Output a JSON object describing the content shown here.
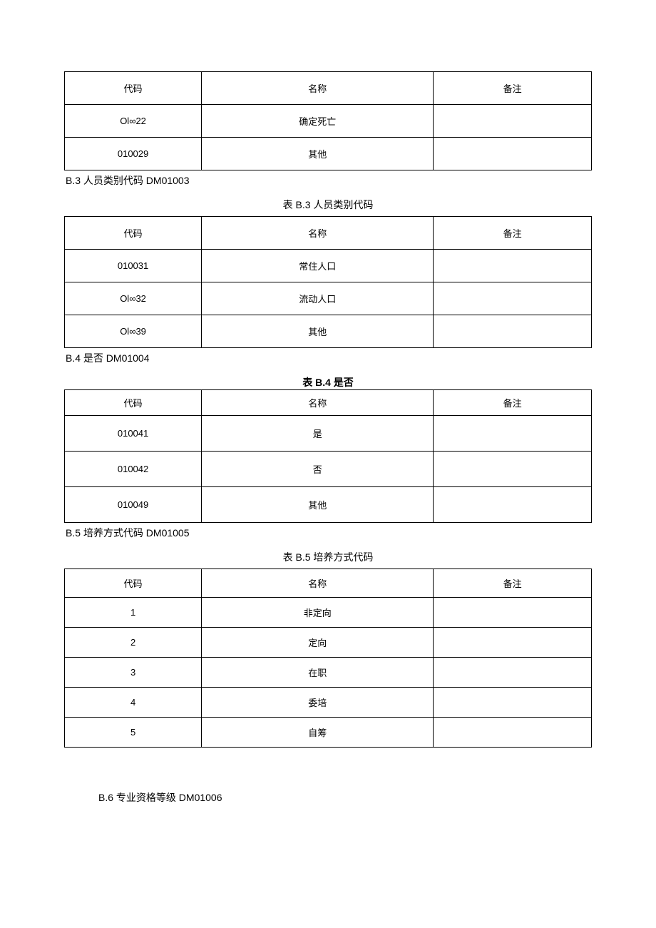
{
  "headers": {
    "code": "代码",
    "name": "名称",
    "note": "备注"
  },
  "tableB2": {
    "rows": [
      {
        "code": "Ol∞22",
        "name": "确定死亡",
        "note": ""
      },
      {
        "code": "010029",
        "name": "其他",
        "note": ""
      }
    ]
  },
  "sectionB3": {
    "heading": "B.3 人员类别代码 DM01003",
    "caption": "表 B.3 人员类别代码",
    "rows": [
      {
        "code": "010031",
        "name": "常住人口",
        "note": ""
      },
      {
        "code": "Ol∞32",
        "name": "流动人口",
        "note": ""
      },
      {
        "code": "Ol∞39",
        "name": "其他",
        "note": ""
      }
    ]
  },
  "sectionB4": {
    "heading": "B.4 是否 DM01004",
    "caption": "表 B.4 是否",
    "rows": [
      {
        "code": "010041",
        "name": "是",
        "note": ""
      },
      {
        "code": "010042",
        "name": "否",
        "note": ""
      },
      {
        "code": "010049",
        "name": "其他",
        "note": ""
      }
    ]
  },
  "sectionB5": {
    "heading": "B.5 培养方式代码 DM01005",
    "caption": "表 B.5 培养方式代码",
    "rows": [
      {
        "code": "1",
        "name": "非定向",
        "note": ""
      },
      {
        "code": "2",
        "name": "定向",
        "note": ""
      },
      {
        "code": "3",
        "name": "在职",
        "note": ""
      },
      {
        "code": "4",
        "name": "委培",
        "note": ""
      },
      {
        "code": "5",
        "name": "自筹",
        "note": ""
      }
    ]
  },
  "sectionB6": {
    "heading": "B.6 专业资格等级 DM01006"
  }
}
